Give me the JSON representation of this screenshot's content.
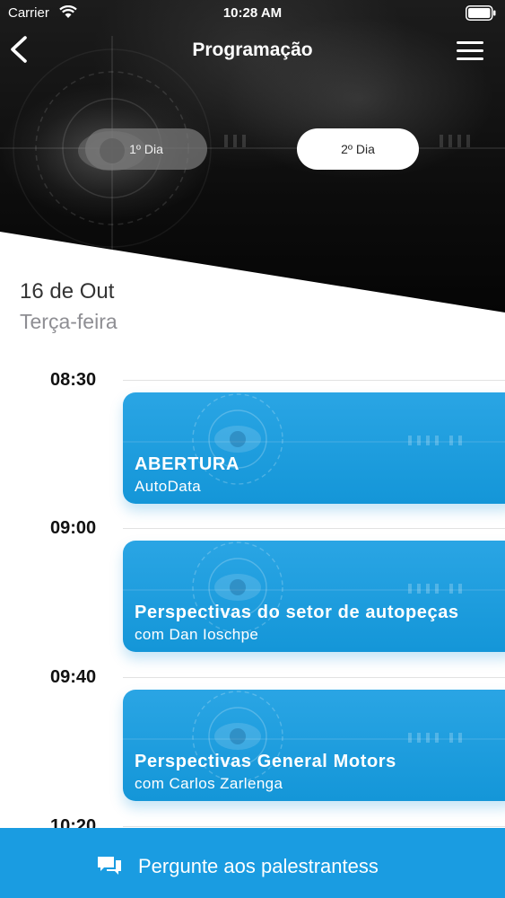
{
  "status_bar": {
    "carrier": "Carrier",
    "time": "10:28 AM"
  },
  "nav": {
    "title": "Programação"
  },
  "days": [
    {
      "label": "1º Dia",
      "selected": false
    },
    {
      "label": "2º Dia",
      "selected": true
    }
  ],
  "date": {
    "day": "16 de Out",
    "weekday": "Terça-feira"
  },
  "schedule": [
    {
      "time": "08:30",
      "title": "ABERTURA",
      "subtitle": "AutoData"
    },
    {
      "time": "09:00",
      "title": "Perspectivas do setor de autopeças",
      "subtitle": "com Dan Ioschpe"
    },
    {
      "time": "09:40",
      "title": "Perspectivas General Motors",
      "subtitle": "com Carlos Zarlenga"
    },
    {
      "time": "10:20"
    }
  ],
  "bottom_bar": {
    "label": "Pergunte aos palestrantess"
  },
  "colors": {
    "accent": "#1a9ce1",
    "card": "#1496d8",
    "header_dark": "#0d0d0d"
  }
}
